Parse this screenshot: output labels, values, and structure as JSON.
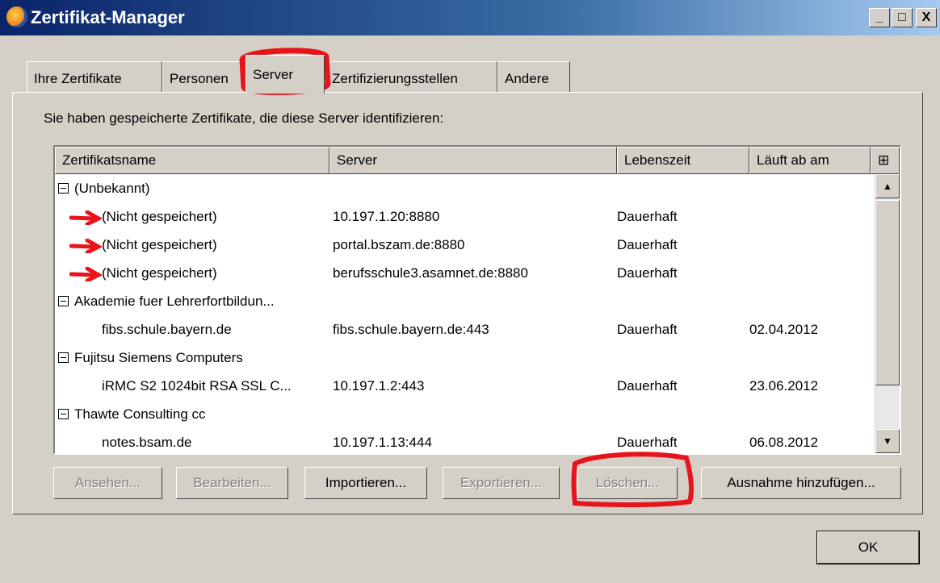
{
  "window": {
    "title": "Zertifikat-Manager",
    "min": "_",
    "max": "□",
    "close": "X"
  },
  "tabs": [
    {
      "label": "Ihre Zertifikate",
      "active": false
    },
    {
      "label": "Personen",
      "active": false
    },
    {
      "label": "Server",
      "active": true
    },
    {
      "label": "Zertifizierungsstellen",
      "active": false
    },
    {
      "label": "Andere",
      "active": false
    }
  ],
  "description": "Sie haben gespeicherte Zertifikate, die diese Server identifizieren:",
  "table": {
    "columns": [
      "Zertifikatsname",
      "Server",
      "Lebenszeit",
      "Läuft ab am"
    ],
    "column_picker": "⊞",
    "rows": [
      {
        "type": "group",
        "name": "(Unbekannt)"
      },
      {
        "type": "item",
        "name": "(Nicht gespeichert)",
        "server": "10.197.1.20:8880",
        "lifetime": "Dauerhaft",
        "expires": "",
        "marked": true
      },
      {
        "type": "item",
        "name": "(Nicht gespeichert)",
        "server": "portal.bszam.de:8880",
        "lifetime": "Dauerhaft",
        "expires": "",
        "marked": true
      },
      {
        "type": "item",
        "name": "(Nicht gespeichert)",
        "server": "berufsschule3.asamnet.de:8880",
        "lifetime": "Dauerhaft",
        "expires": "",
        "marked": true
      },
      {
        "type": "group",
        "name": "Akademie fuer Lehrerfortbildun..."
      },
      {
        "type": "item",
        "name": "fibs.schule.bayern.de",
        "server": "fibs.schule.bayern.de:443",
        "lifetime": "Dauerhaft",
        "expires": "02.04.2012",
        "marked": false
      },
      {
        "type": "group",
        "name": "Fujitsu Siemens Computers"
      },
      {
        "type": "item",
        "name": "iRMC S2 1024bit RSA SSL C...",
        "server": "10.197.1.2:443",
        "lifetime": "Dauerhaft",
        "expires": "23.06.2012",
        "marked": false
      },
      {
        "type": "group",
        "name": "Thawte Consulting cc"
      },
      {
        "type": "item",
        "name": "notes.bsam.de",
        "server": "10.197.1.13:444",
        "lifetime": "Dauerhaft",
        "expires": "06.08.2012",
        "marked": false
      }
    ]
  },
  "scrollbar": {
    "up": "▲",
    "down": "▼"
  },
  "buttons": {
    "view": "Ansehen...",
    "edit": "Bearbeiten...",
    "import": "Importieren...",
    "export": "Exportieren...",
    "delete": "Löschen...",
    "add_exception": "Ausnahme hinzufügen...",
    "ok": "OK"
  },
  "colors": {
    "annotation": "#e8141c",
    "titlebar": "#0a246a",
    "face": "#d4d0c8"
  }
}
